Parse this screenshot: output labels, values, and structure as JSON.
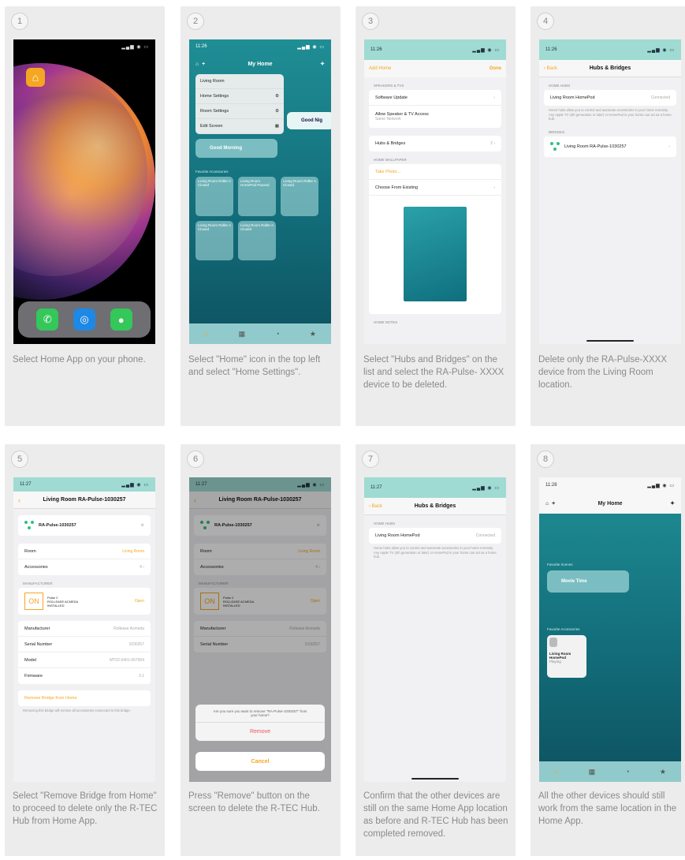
{
  "steps": [
    {
      "num": "1",
      "caption": "Select Home App on your phone."
    },
    {
      "num": "2",
      "caption": "Select \"Home\" icon in the top left and select \"Home Settings\"."
    },
    {
      "num": "3",
      "caption": "Select \"Hubs and Bridges\" on the list and select the RA-Pulse- XXXX device to be deleted."
    },
    {
      "num": "4",
      "caption": "Delete only the RA-Pulse-XXXX device from the Living Room location."
    },
    {
      "num": "5",
      "caption": "Select \"Remove Bridge from Home\" to proceed to delete only the R-TEC Hub from Home App."
    },
    {
      "num": "6",
      "caption": "Press \"Remove\" button on the screen to delete the R-TEC Hub."
    },
    {
      "num": "7",
      "caption": "Confirm that the other devices are still on the same Home App location as before and R-TEC Hub has been completed removed."
    },
    {
      "num": "8",
      "caption": "All the other devices should still work from the same location in the Home App."
    }
  ],
  "screen2": {
    "time": "11:26",
    "title": "My Home",
    "menu": [
      "Living Room",
      "Home Settings",
      "Room Settings",
      "Edit Screen"
    ],
    "scene_good_morning": "Good Morning",
    "scene_good_night": "Good Nig",
    "fav_label": "Favorite Accessories",
    "tiles": [
      "Living Room Roller A Closed",
      "Living Room HomePod Paused",
      "Living Room Roller A Closed",
      "Living Room Roller A Closed",
      "Living Room Roller A Closed"
    ]
  },
  "screen3": {
    "time": "11:26",
    "add_home": "Add Home",
    "done": "Done",
    "section1": "Speakers & TVs",
    "software_update": "Software Update",
    "allow_speaker": "Allow Speaker & TV Access",
    "same_network": "Same Network",
    "hubs": "Hubs & Bridges",
    "hubs_count": "2",
    "wallpaper": "Home Wallpaper",
    "take_photo": "Take Photo...",
    "choose": "Choose From Existing",
    "home_notes": "Home Notes"
  },
  "screen4": {
    "time": "11:26",
    "back": "Back",
    "title": "Hubs & Bridges",
    "home_hubs": "Home Hubs",
    "homepod": "Living Room HomePod",
    "connected": "Connected",
    "note": "Home hubs allow you to control and automate accessories in your home remotely. Any Apple TV (4th generation or later) or HomePod in your home can act as a home hub.",
    "bridges": "Bridges",
    "bridge_name": "Living Room RA-Pulse-1030257"
  },
  "screen5": {
    "time": "11:27",
    "title": "Living Room RA-Pulse-1030257",
    "device": "RA-Pulse-1030257",
    "room": "Room",
    "room_val": "Living Room",
    "accessories": "Accessories",
    "accessories_val": "4",
    "manufacturer_sect": "Manufacturer",
    "pulse_line1": "Pulse 2",
    "pulse_line2": "ROLLEASE ACMEDA",
    "pulse_line3": "INSTALLED",
    "open": "Open",
    "on_logo": "ON",
    "manufacturer": "Manufacturer",
    "manufacturer_val": "Rollease Acmeda",
    "serial": "Serial Number",
    "serial_val": "1030257",
    "model": "Model",
    "model_val": "MT02-0401-067004",
    "firmware": "Firmware",
    "firmware_val": "3.1",
    "remove": "Remove Bridge from Home",
    "remove_note": "Removing this bridge will remove all accessories connected to this bridge."
  },
  "screen6": {
    "time": "11:27",
    "alert_msg": "Are you sure you want to remove \"RA-Pulse-1030257\" from your home?",
    "remove": "Remove",
    "cancel": "Cancel"
  },
  "screen7": {
    "time": "11:27",
    "back": "Back",
    "title": "Hubs & Bridges",
    "home_hubs": "Home Hubs",
    "homepod": "Living Room HomePod",
    "connected": "Connected",
    "note": "Home hubs allow you to control and automate accessories in your home remotely. Any Apple TV (4th generation or later) or HomePod in your home can act as a home hub."
  },
  "screen8": {
    "time": "11:28",
    "title": "My Home",
    "fav_scenes": "Favorite Scenes",
    "movie_time": "Movie Time",
    "fav_acc": "Favorite Accessories",
    "tile_name": "Living Room HomePod",
    "tile_state": "Playing"
  }
}
